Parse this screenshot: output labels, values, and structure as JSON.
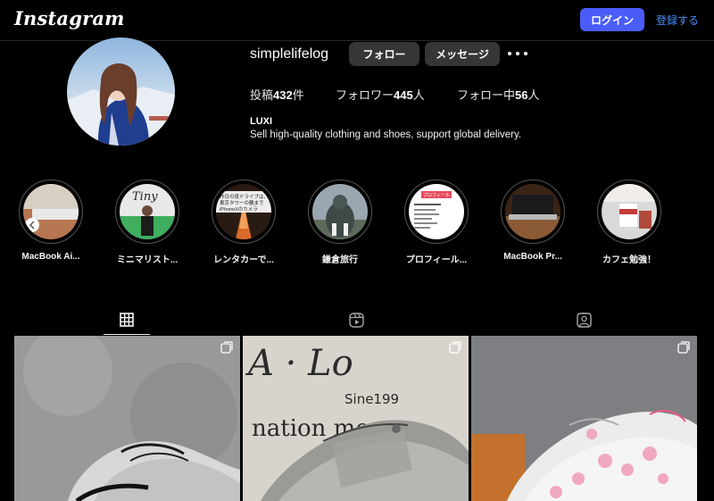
{
  "nav": {
    "logo": "Instagram",
    "login_label": "ログイン",
    "signup_label": "登録する"
  },
  "profile": {
    "username": "simplelifelog",
    "follow_label": "フォロー",
    "message_label": "メッセージ",
    "stats": {
      "posts_prefix": "投稿",
      "posts_count": "432",
      "posts_suffix": "件",
      "followers_prefix": "フォロワー",
      "followers_count": "445",
      "followers_suffix": "人",
      "following_prefix": "フォロー中",
      "following_count": "56",
      "following_suffix": "人"
    },
    "bio_name": "LUXI",
    "bio_text": "Sell high-quality clothing and shoes, support global delivery."
  },
  "highlights": [
    {
      "label": "MacBook Ai..."
    },
    {
      "label": "ミニマリスト..."
    },
    {
      "label": "レンタカーで..."
    },
    {
      "label": "鎌倉旅行"
    },
    {
      "label": "プロフィール..."
    },
    {
      "label": "MacBook Pr..."
    },
    {
      "label": "カフェ勉強！"
    }
  ],
  "highlight_overlay_text": {
    "h3": "昨日の夜ドライブは、東京タワーの麓まで iPhoneXのカメラすごいな〜",
    "h5": "プロフィール"
  },
  "post_overlay_text": {
    "post2_line1": "A · Lo",
    "post2_line2": "Sine199",
    "post2_line3": "nation  mo"
  },
  "tabs": [
    "grid-icon",
    "reels-icon",
    "tagged-icon"
  ],
  "colors": {
    "accent": "#4a5df9",
    "link": "#4a8ff8",
    "background": "#000000"
  }
}
